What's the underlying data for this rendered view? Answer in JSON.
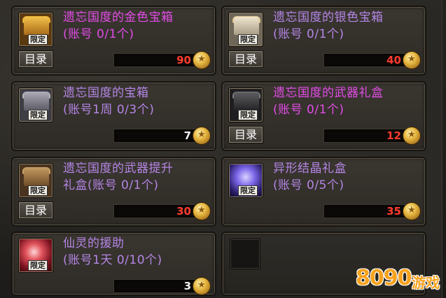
{
  "items": [
    {
      "title": "遗忘国度的金色宝箱",
      "sub": "(账号 0/1个)",
      "color": "pink",
      "has_catalog": true,
      "price": "90",
      "limited": "限定",
      "icon": "gold-chest-icon",
      "icon_color": "#d49a2a"
    },
    {
      "title": "遗忘国度的银色宝箱",
      "sub": "(账号 0/1个)",
      "color": "purple",
      "has_catalog": true,
      "price": "40",
      "limited": "限定",
      "icon": "silver-chest-icon",
      "icon_color": "#c8c2b4"
    },
    {
      "title": "遗忘国度的宝箱",
      "sub": "(账号1周 0/3个)",
      "color": "purple",
      "has_catalog": false,
      "price": "7",
      "limited": "限定",
      "icon": "chest-icon",
      "icon_color": "#8d8c95"
    },
    {
      "title": "遗忘国度的武器礼盒",
      "sub": "(账号 0/1个)",
      "color": "pink",
      "has_catalog": true,
      "price": "12",
      "limited": "限定",
      "icon": "weapon-box-icon",
      "icon_color": "#4a4a4c"
    },
    {
      "title": "遗忘国度的武器提升",
      "sub": "礼盒(账号 0/1个)",
      "color": "purple",
      "has_catalog": true,
      "price": "30",
      "limited": "限定",
      "icon": "weapon-upgrade-box-icon",
      "icon_color": "#a07e4e"
    },
    {
      "title": "异形结晶礼盒",
      "sub": "(账号 0/5个)",
      "color": "purple",
      "has_catalog": false,
      "price": "35",
      "limited": "限定",
      "icon": "crystal-orb-icon",
      "icon_color": "#6a5acd"
    },
    {
      "title": "仙灵的援助",
      "sub": "(账号1天 0/10个)",
      "color": "purple",
      "has_catalog": false,
      "price": "3",
      "limited": "限定",
      "icon": "fairy-aid-icon",
      "icon_color": "#b03a3a"
    }
  ],
  "catalog_label": "目录",
  "watermark": {
    "number": "8090",
    "text": "游戏"
  }
}
